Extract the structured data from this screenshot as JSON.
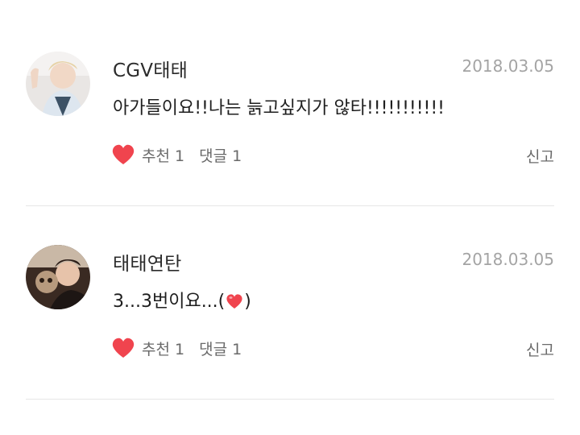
{
  "comments": [
    {
      "author": "CGV태태",
      "date": "2018.03.05",
      "text": "아가들이요!!나는 늙고싶지가 않타!!!!!!!!!!!",
      "text_before_heart": "",
      "text_after_heart": "",
      "like_label": "추천",
      "like_count": "1",
      "reply_label": "댓글",
      "reply_count": "1",
      "report_label": "신고"
    },
    {
      "author": "태태연탄",
      "date": "2018.03.05",
      "text": "",
      "text_before_heart": "3...3번이요...(",
      "text_after_heart": ")",
      "like_label": "추천",
      "like_count": "1",
      "reply_label": "댓글",
      "reply_count": "1",
      "report_label": "신고"
    }
  ],
  "colors": {
    "heart": "#f0444e",
    "date": "#a4a4a4",
    "divider": "#e6e6e6"
  },
  "icons": {
    "like": "heart-icon",
    "inline_emoji": "heart-emoji-icon"
  }
}
